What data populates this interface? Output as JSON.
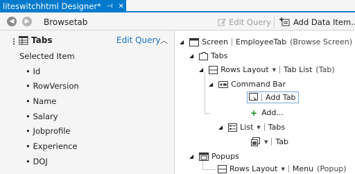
{
  "document_tab": {
    "title": "liteswitchhtml Designer*",
    "pin_icon": "pin-icon",
    "close_icon": "close-icon"
  },
  "toolbar": {
    "screen_name": "Browsetab",
    "edit_query_label": "Edit Query",
    "add_data_item_label": "Add Data Item..."
  },
  "left_panel": {
    "title": "Tabs",
    "edit_query_link": "Edit Query",
    "group_label": "Selected Item",
    "properties": [
      "Id",
      "RowVersion",
      "Name",
      "Salary",
      "Jobprofile",
      "Experience",
      "DOJ"
    ]
  },
  "tree": {
    "screen_label": "Screen",
    "screen_name": "EmployeeTab",
    "screen_type": "(Browse Screen)",
    "tabs_label": "Tabs",
    "rows_layout_label": "Rows Layout",
    "tab_list_label": "Tab List",
    "tab_list_type": "(Tab)",
    "command_bar_label": "Command Bar",
    "add_tab_label": "Add Tab",
    "add_more_label": "Add...",
    "list_label": "List",
    "list_source": "Tabs",
    "tab_item_label": "Tab",
    "popups_label": "Popups",
    "popup_rows_layout_label": "Rows Layout",
    "menu_label": "Menu",
    "menu_type": "(Popup)"
  },
  "colors": {
    "accent": "#007acc",
    "link": "#1a73c7",
    "add_green": "#1e8a1e"
  }
}
